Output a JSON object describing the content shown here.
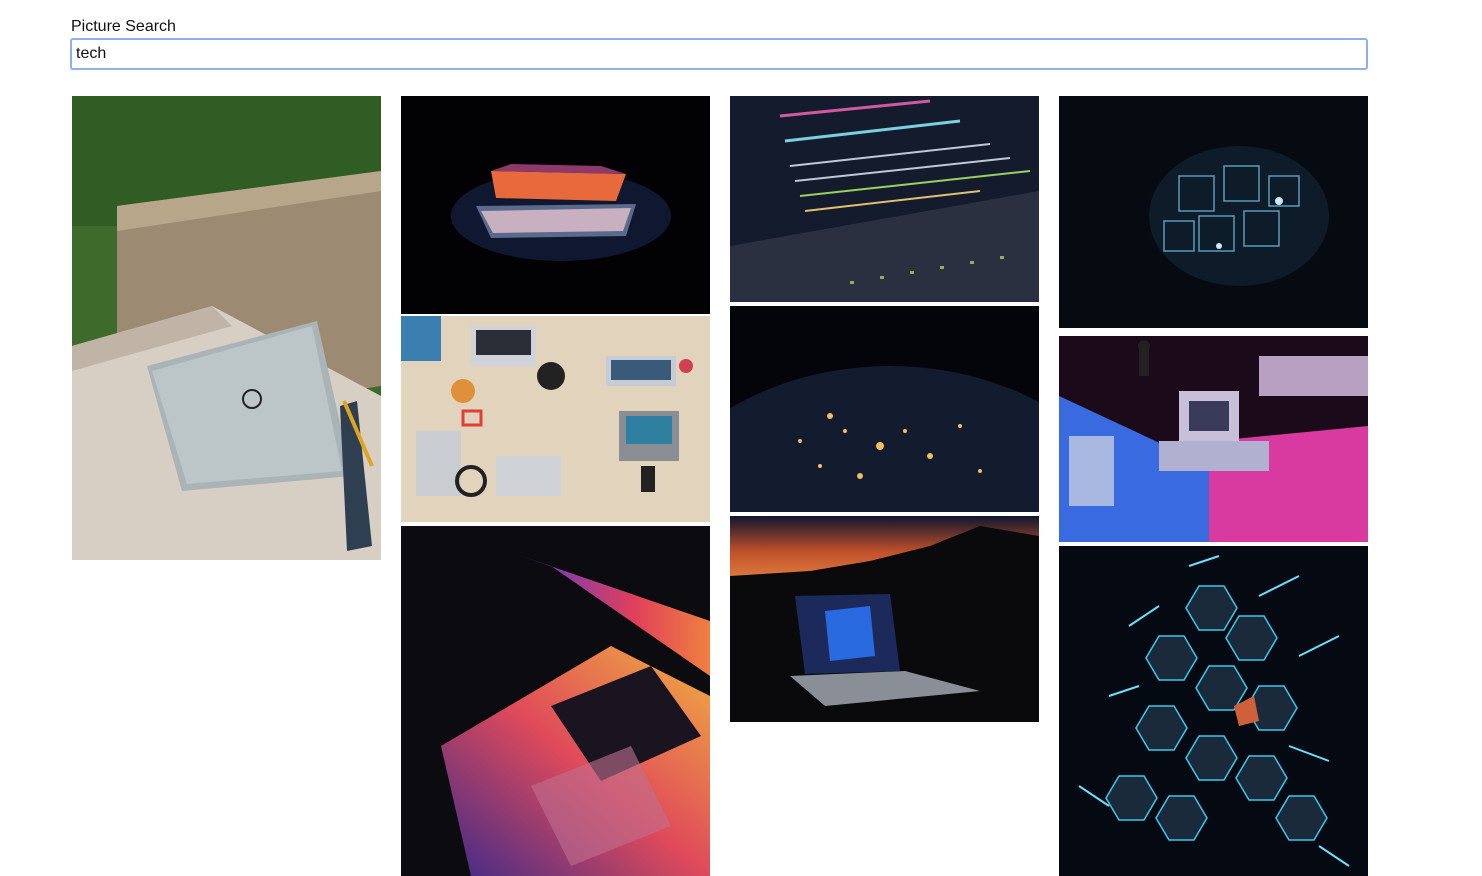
{
  "search": {
    "label": "Picture Search",
    "value": "tech"
  },
  "results": [
    {
      "icon": "dell-laptop-on-stone-bench-image"
    },
    {
      "icon": "glowing-laptop-dark-image"
    },
    {
      "icon": "team-laptops-desk-image"
    },
    {
      "icon": "macbook-gradient-keyboard-image"
    },
    {
      "icon": "code-on-screen-image"
    },
    {
      "icon": "earth-night-lights-image"
    },
    {
      "icon": "windows-laptop-sunset-image"
    },
    {
      "icon": "neon-cubes-structure-image"
    },
    {
      "icon": "retro-computers-neon-image"
    },
    {
      "icon": "neon-hexagon-abstract-image"
    }
  ]
}
